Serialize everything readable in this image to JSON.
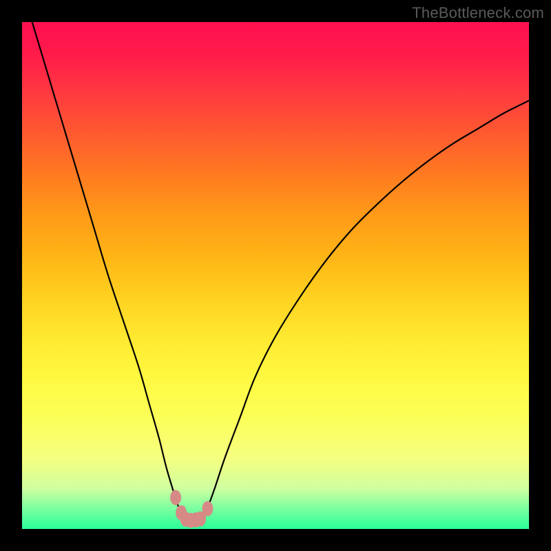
{
  "watermark": "TheBottleneck.com",
  "chart_data": {
    "type": "line",
    "title": "",
    "xlabel": "",
    "ylabel": "",
    "xlim": [
      0,
      100
    ],
    "ylim": [
      0,
      100
    ],
    "series": [
      {
        "name": "bottleneck-curve",
        "x": [
          2,
          5,
          8,
          11,
          14,
          17,
          20,
          23,
          25,
          27,
          28.5,
          30,
          31,
          32,
          32.8,
          33.5,
          34.5,
          35.5,
          36.5,
          38,
          40,
          43,
          46,
          50,
          55,
          60,
          65,
          70,
          75,
          80,
          85,
          90,
          95,
          100
        ],
        "y": [
          100,
          90,
          80,
          70,
          60,
          50,
          41,
          32,
          25,
          18,
          12,
          7,
          4,
          2.3,
          1.8,
          1.8,
          2,
          2.5,
          4,
          8,
          14,
          22,
          30,
          38,
          46,
          53,
          59,
          64,
          68.5,
          72.5,
          76,
          79,
          82,
          84.5
        ]
      }
    ],
    "marker_points": {
      "name": "salmon-markers",
      "color": "#d68a86",
      "points": [
        {
          "x": 30.3,
          "y": 6.2
        },
        {
          "x": 31.4,
          "y": 3.2
        },
        {
          "x": 32.3,
          "y": 1.9
        },
        {
          "x": 33.3,
          "y": 1.7
        },
        {
          "x": 34.3,
          "y": 1.8
        },
        {
          "x": 35.2,
          "y": 2.0
        },
        {
          "x": 36.6,
          "y": 4.0
        }
      ]
    },
    "background_gradient": {
      "top_color": "#ff1050",
      "bottom_color": "#2aff99"
    }
  }
}
